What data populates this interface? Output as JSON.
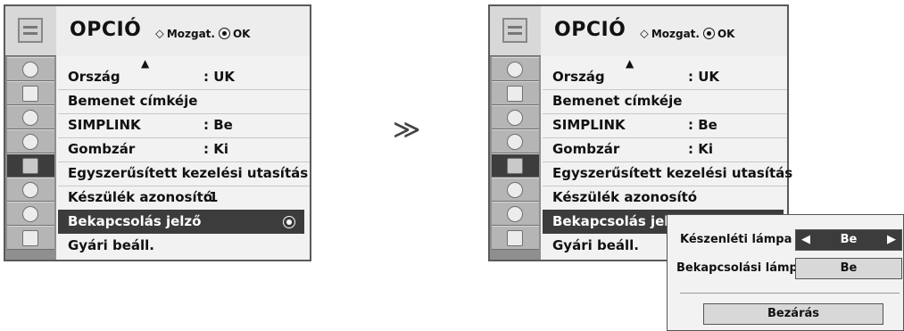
{
  "menu": {
    "title": "OPCIÓ",
    "nav_label": "Mozgat.",
    "ok_label": "OK",
    "items": [
      {
        "label": "Ország",
        "value": ": UK"
      },
      {
        "label": "Bemenet címkéje",
        "value": ""
      },
      {
        "label": "SIMPLINK",
        "value": ": Be"
      },
      {
        "label": "Gombzár",
        "value": ": Ki"
      },
      {
        "label": "Egyszerűsített kezelési utasítás",
        "value": ""
      },
      {
        "label": "Készülék azonosító",
        "value": ":1"
      },
      {
        "label": "Bekapcsolás jelző",
        "value": ""
      },
      {
        "label": "Gyári beáll.",
        "value": ""
      }
    ],
    "right_items": [
      {
        "label": "Ország",
        "value": ": UK"
      },
      {
        "label": "Bemenet címkéje",
        "value": ""
      },
      {
        "label": "SIMPLINK",
        "value": ": Be"
      },
      {
        "label": "Gombzár",
        "value": ": Ki"
      },
      {
        "label": "Egyszerűsített kezelési utasítás",
        "value": ""
      },
      {
        "label": "Készülék azonosító",
        "value": ""
      },
      {
        "label": "Bekapcsolás jelző",
        "value": ""
      },
      {
        "label": "Gyári beáll.",
        "value": ""
      }
    ]
  },
  "popup": {
    "standby_label": "Készenléti lámpa",
    "standby_value": "Be",
    "power_label": "Bekapcsolási lámpa",
    "power_value": "Be",
    "close_label": "Bezárás"
  },
  "transition_symbol": "≫",
  "colors": {
    "highlight": "#3c3c3c",
    "icon_column": "#8f8f8f",
    "panel": "#ededed"
  }
}
